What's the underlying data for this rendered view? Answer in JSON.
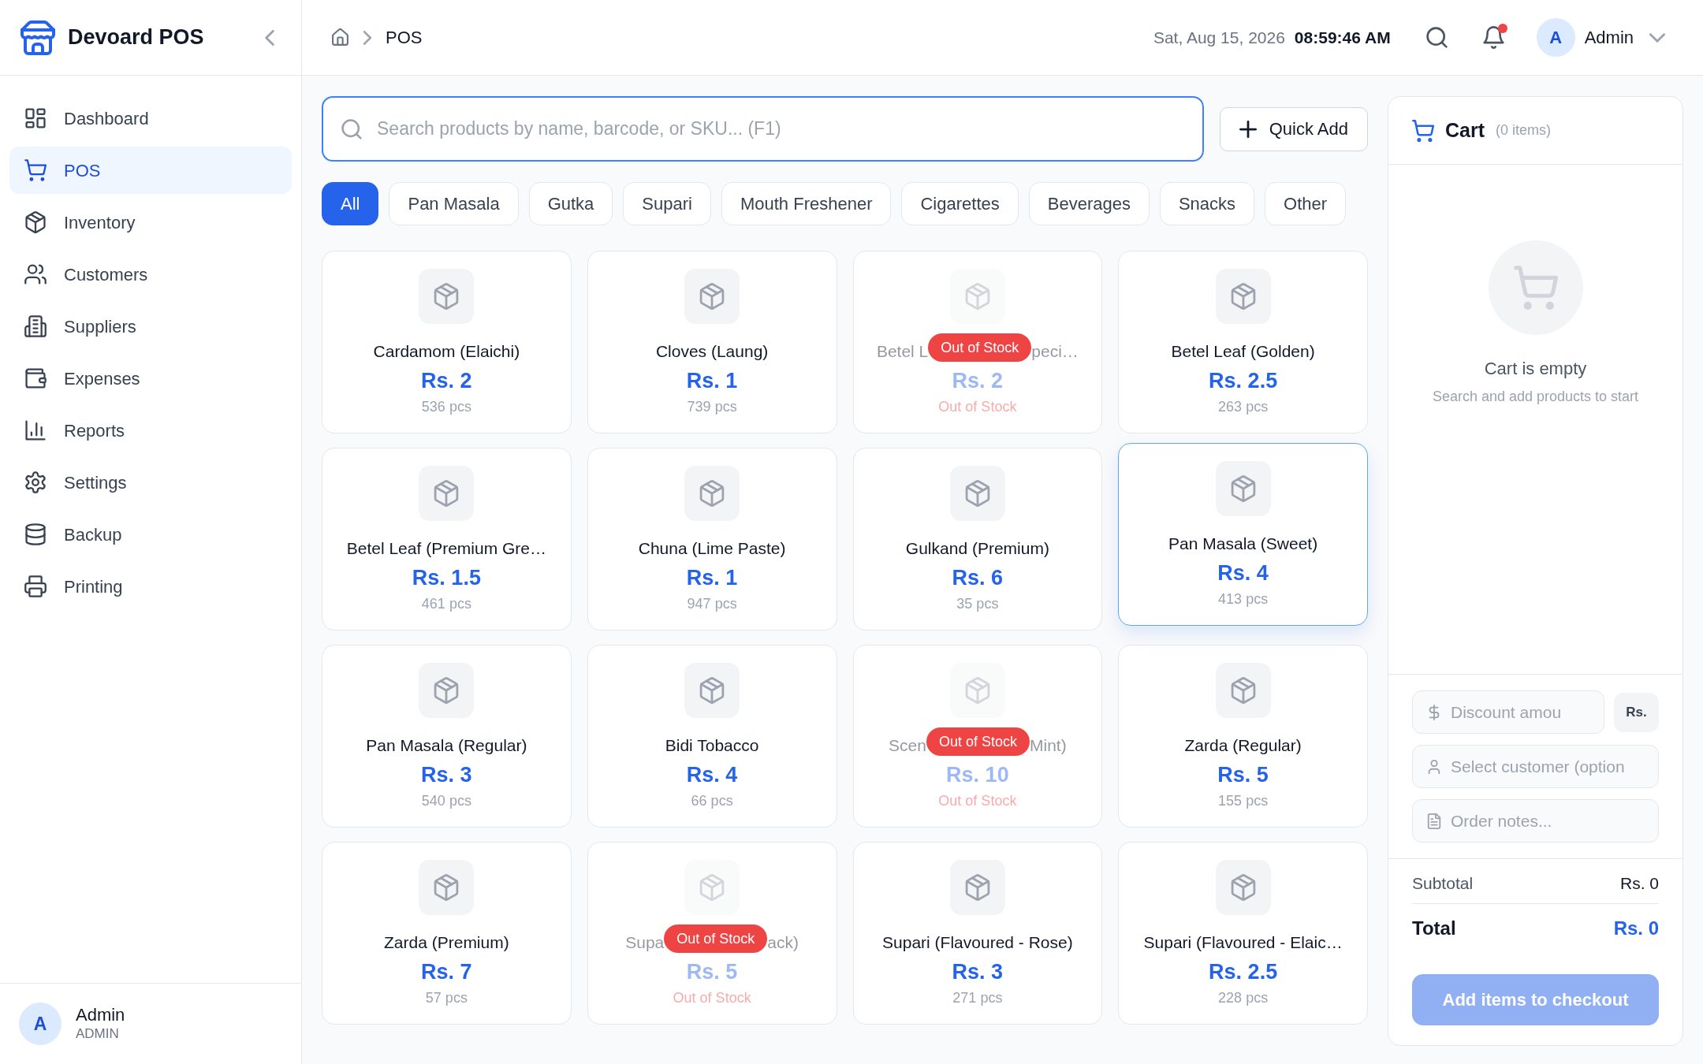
{
  "sidebar": {
    "brand": "Devoard POS",
    "items": [
      {
        "label": "Dashboard",
        "selected": false
      },
      {
        "label": "POS",
        "selected": true
      },
      {
        "label": "Inventory",
        "selected": false
      },
      {
        "label": "Customers",
        "selected": false
      },
      {
        "label": "Suppliers",
        "selected": false
      },
      {
        "label": "Expenses",
        "selected": false
      },
      {
        "label": "Reports",
        "selected": false
      },
      {
        "label": "Settings",
        "selected": false
      },
      {
        "label": "Backup",
        "selected": false
      },
      {
        "label": "Printing",
        "selected": false
      }
    ],
    "user": {
      "initial": "A",
      "name": "Admin",
      "role": "ADMIN"
    }
  },
  "header": {
    "breadcrumb": "POS",
    "date": "Sat, Aug 15, 2026",
    "time": "08:59:46 AM",
    "notifications_unread": true,
    "user": {
      "initial": "A",
      "name": "Admin"
    }
  },
  "search": {
    "placeholder": "Search products by name, barcode, or SKU... (F1)"
  },
  "quick_add": {
    "label": "Quick Add"
  },
  "categories": [
    {
      "label": "All",
      "selected": true
    },
    {
      "label": "Pan Masala",
      "selected": false
    },
    {
      "label": "Gutka",
      "selected": false
    },
    {
      "label": "Supari",
      "selected": false
    },
    {
      "label": "Mouth Freshener",
      "selected": false
    },
    {
      "label": "Cigarettes",
      "selected": false
    },
    {
      "label": "Beverages",
      "selected": false
    },
    {
      "label": "Snacks",
      "selected": false
    },
    {
      "label": "Other",
      "selected": false
    }
  ],
  "products": [
    {
      "name": "Cardamom (Elaichi)",
      "price": "Rs. 2",
      "stock": "536 pcs",
      "out_of_stock": false,
      "selected": false
    },
    {
      "name": "Cloves (Laung)",
      "price": "Rs. 1",
      "stock": "739 pcs",
      "out_of_stock": false,
      "selected": false
    },
    {
      "name_parts": [
        "Betel L",
        "peci…"
      ],
      "badge": "Out of Stock",
      "price": "Rs. 2",
      "stock": "Out of Stock",
      "out_of_stock": true,
      "selected": false
    },
    {
      "name": "Betel Leaf (Golden)",
      "price": "Rs. 2.5",
      "stock": "263 pcs",
      "out_of_stock": false,
      "selected": false
    },
    {
      "name": "Betel Leaf (Premium Gre…",
      "price": "Rs. 1.5",
      "stock": "461 pcs",
      "out_of_stock": false,
      "selected": false
    },
    {
      "name": "Chuna (Lime Paste)",
      "price": "Rs. 1",
      "stock": "947 pcs",
      "out_of_stock": false,
      "selected": false
    },
    {
      "name": "Gulkand (Premium)",
      "price": "Rs. 6",
      "stock": "35 pcs",
      "out_of_stock": false,
      "selected": false
    },
    {
      "name": "Pan Masala (Sweet)",
      "price": "Rs. 4",
      "stock": "413 pcs",
      "out_of_stock": false,
      "selected": true
    },
    {
      "name": "Pan Masala (Regular)",
      "price": "Rs. 3",
      "stock": "540 pcs",
      "out_of_stock": false,
      "selected": false
    },
    {
      "name": "Bidi Tobacco",
      "price": "Rs. 4",
      "stock": "66 pcs",
      "out_of_stock": false,
      "selected": false
    },
    {
      "name_parts": [
        "Scen",
        "Mint)"
      ],
      "badge": "Out of Stock",
      "price": "Rs. 10",
      "stock": "Out of Stock",
      "out_of_stock": true,
      "selected": false
    },
    {
      "name": "Zarda (Regular)",
      "price": "Rs. 5",
      "stock": "155 pcs",
      "out_of_stock": false,
      "selected": false
    },
    {
      "name": "Zarda (Premium)",
      "price": "Rs. 7",
      "stock": "57 pcs",
      "out_of_stock": false,
      "selected": false
    },
    {
      "name_parts": [
        "Supa",
        "ack)"
      ],
      "badge": "Out of Stock",
      "price": "Rs. 5",
      "stock": "Out of Stock",
      "out_of_stock": true,
      "selected": false
    },
    {
      "name": "Supari (Flavoured - Rose)",
      "price": "Rs. 3",
      "stock": "271 pcs",
      "out_of_stock": false,
      "selected": false
    },
    {
      "name": "Supari (Flavoured - Elaic…",
      "price": "Rs. 2.5",
      "stock": "228 pcs",
      "out_of_stock": false,
      "selected": false
    }
  ],
  "cart": {
    "title": "Cart",
    "count": "(0 items)",
    "empty_title": "Cart is empty",
    "empty_hint": "Search and add products to start",
    "discount": {
      "placeholder": "Discount amou"
    },
    "discount_unit": "Rs.",
    "customer": {
      "placeholder": "Select customer (option"
    },
    "notes": {
      "placeholder": "Order notes..."
    },
    "subtotal": {
      "label": "Subtotal",
      "value": "Rs. 0"
    },
    "total": {
      "label": "Total",
      "value": "Rs. 0"
    },
    "checkout": {
      "label": "Add items to checkout",
      "disabled": true
    }
  }
}
